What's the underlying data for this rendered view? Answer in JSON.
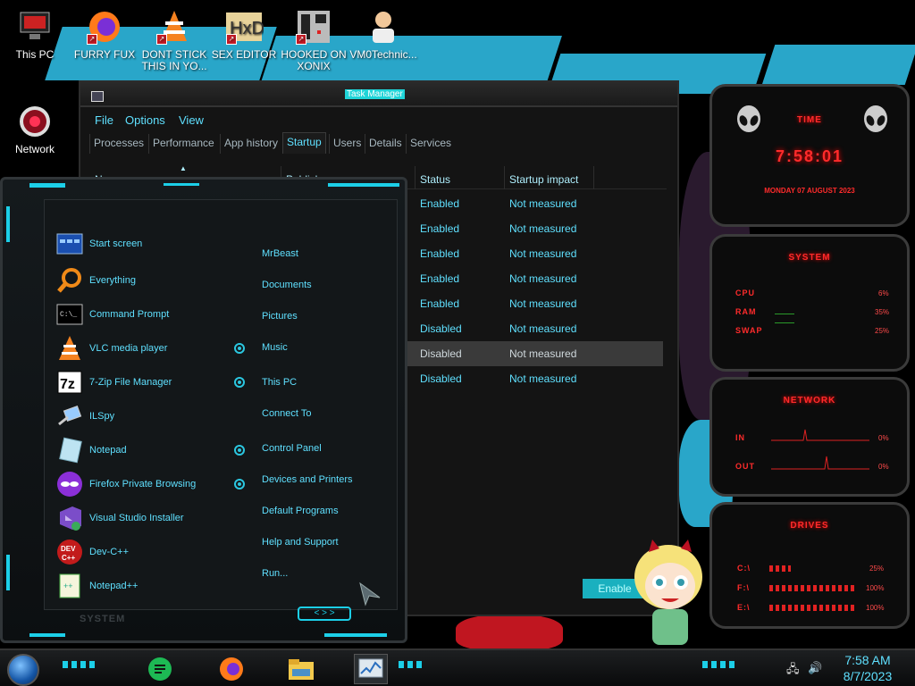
{
  "desktop": {
    "icons": [
      {
        "name": "this-pc",
        "label": "This PC"
      },
      {
        "name": "firefox",
        "label": "FURRY FUX"
      },
      {
        "name": "vlc",
        "label": "DONT STICK THIS IN YO..."
      },
      {
        "name": "hex-editor",
        "label": "SEX EDITOR"
      },
      {
        "name": "xonix",
        "label": "HOOKED ON XONIX"
      },
      {
        "name": "vm0",
        "label": "VM0Technic..."
      },
      {
        "name": "network",
        "label": "Network"
      }
    ]
  },
  "task_manager": {
    "title": "Task Manager",
    "menu": [
      "File",
      "Options",
      "View"
    ],
    "tabs": [
      "Processes",
      "Performance",
      "App history",
      "Startup",
      "Users",
      "Details",
      "Services"
    ],
    "active_tab": "Startup",
    "columns": {
      "name": "Name",
      "publisher": "Publisher",
      "status": "Status",
      "impact": "Startup impact"
    },
    "rows": [
      {
        "status": "Enabled",
        "impact": "Not measured"
      },
      {
        "status": "Enabled",
        "impact": "Not measured"
      },
      {
        "status": "Enabled",
        "impact": "Not measured"
      },
      {
        "status": "Enabled",
        "impact": "Not measured"
      },
      {
        "status": "Enabled",
        "impact": "Not measured"
      },
      {
        "status": "Disabled",
        "impact": "Not measured"
      },
      {
        "status": "Disabled",
        "impact": "Not measured"
      },
      {
        "status": "Disabled",
        "impact": "Not measured"
      }
    ],
    "enable_button": "Enable"
  },
  "start_menu": {
    "programs": [
      "Start screen",
      "Everything",
      "Command Prompt",
      "VLC media player",
      "7-Zip File Manager",
      "ILSpy",
      "Notepad",
      "Firefox Private Browsing",
      "Visual Studio Installer",
      "Dev-C++",
      "Notepad++"
    ],
    "places": [
      "MrBeast",
      "Documents",
      "Pictures",
      "Music",
      "This PC",
      "Connect To",
      "Control Panel",
      "Devices and Printers",
      "Default Programs",
      "Help and Support",
      "Run..."
    ],
    "footer": "SYSTEM"
  },
  "gadgets": {
    "time": {
      "title": "TIME",
      "clock": "7:58:01",
      "date": "MONDAY 07 AUGUST 2023"
    },
    "system": {
      "title": "SYSTEM",
      "rows": [
        {
          "label": "CPU",
          "value": "6%"
        },
        {
          "label": "RAM",
          "value": "35%"
        },
        {
          "label": "SWAP",
          "value": "25%"
        }
      ]
    },
    "network": {
      "title": "NETWORK",
      "rows": [
        {
          "label": "IN",
          "value": "0%"
        },
        {
          "label": "OUT",
          "value": "0%"
        }
      ]
    },
    "drives": {
      "title": "DRIVES",
      "rows": [
        {
          "label": "C:\\",
          "value": "25%"
        },
        {
          "label": "F:\\",
          "value": "100%"
        },
        {
          "label": "E:\\",
          "value": "100%"
        }
      ]
    }
  },
  "taskbar": {
    "apps": [
      "green-app",
      "firefox",
      "file-explorer",
      "task-manager"
    ],
    "active_app": "task-manager",
    "time": "7:58 AM",
    "date": "8/7/2023"
  },
  "colors": {
    "accent": "#5fe0ff",
    "gadget_red": "#ff2b2b",
    "selected_row": "#3a3a3a",
    "enable_button": "#1ab0bf"
  }
}
